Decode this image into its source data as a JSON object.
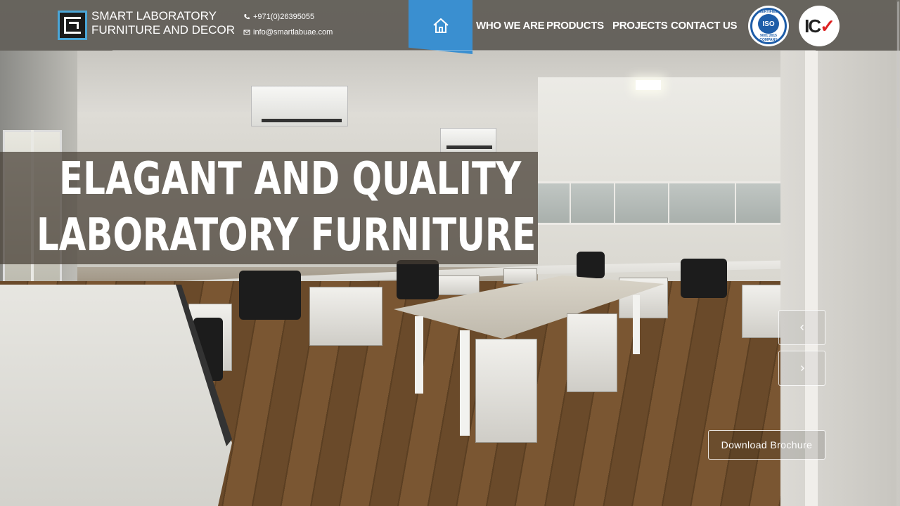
{
  "header": {
    "brand_line1": "SMART LABORATORY",
    "brand_line2": "FURNITURE AND DECOR",
    "phone": "+971(0)26395055",
    "email": "info@smartlabuae.com",
    "home_icon": "home-icon",
    "nav": [
      "WHO WE ARE",
      "PRODUCTS",
      "PROJECTS",
      "CONTACT US"
    ],
    "accent_color": "#3a8fd0"
  },
  "badges": {
    "iso_top": "CERTIFIED",
    "iso_mid": "ISO",
    "iso_num": "9001:2015",
    "iso_bottom": "COMPANY",
    "icv_text": "ICV"
  },
  "hero": {
    "title_line1": "ELAGANT AND QUALITY",
    "title_line2": "LABORATORY FURNITURE",
    "prev_icon": "chevron-left-icon",
    "next_icon": "chevron-right-icon",
    "brochure_label": "Download Brochure"
  }
}
